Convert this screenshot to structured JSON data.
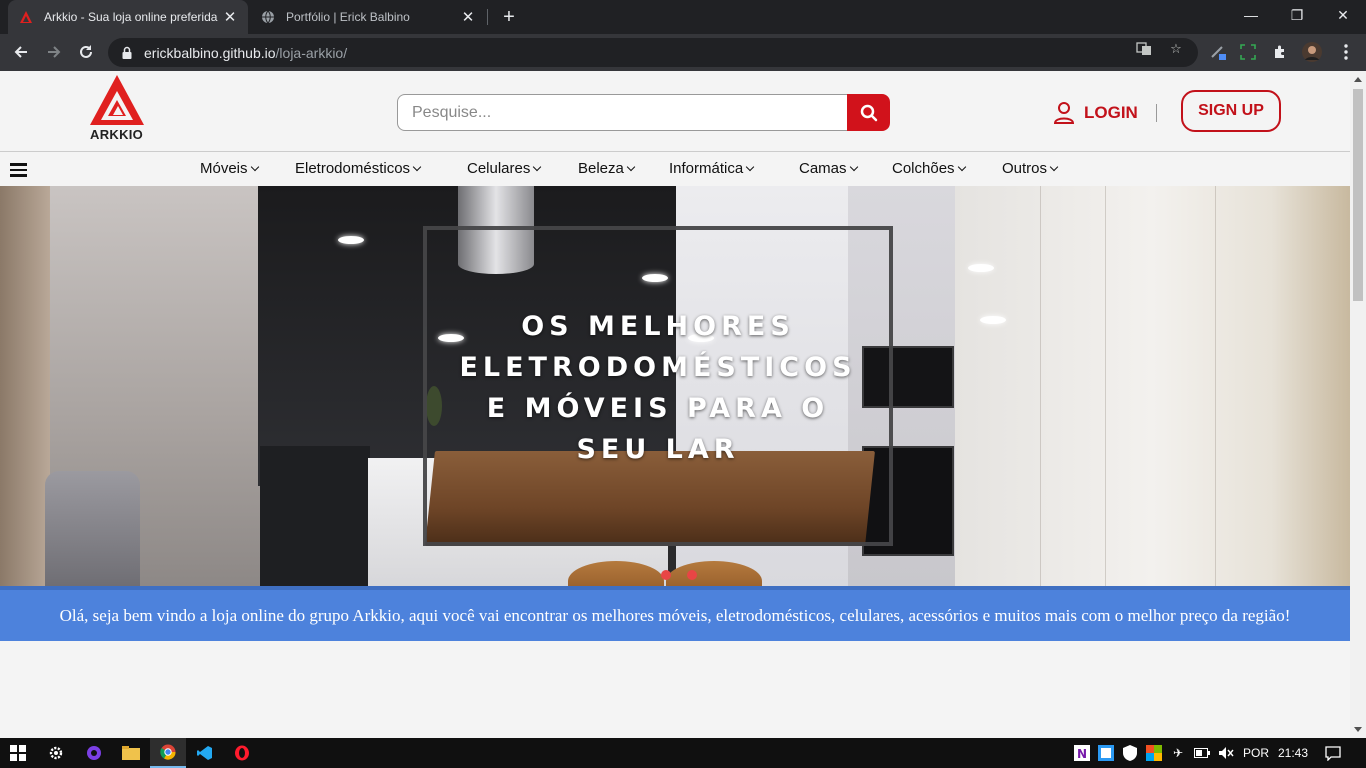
{
  "browser": {
    "tabs": [
      {
        "title": "Arkkio - Sua loja online preferida",
        "active": true
      },
      {
        "title": "Portfólio | Erick Balbino",
        "active": false
      }
    ],
    "url_host": "erickbalbino.github.io",
    "url_path": "/loja-arkkio/"
  },
  "header": {
    "logo_text": "ARKKIO",
    "search_placeholder": "Pesquise...",
    "login_label": "LOGIN",
    "separator": "|",
    "signup_label": "SIGN UP"
  },
  "nav": {
    "categories": [
      "Móveis",
      "Eletrodomésticos",
      "Celulares",
      "Beleza",
      "Informática",
      "Camas",
      "Colchões",
      "Outros"
    ]
  },
  "hero": {
    "lines": [
      "OS MELHORES",
      "ELETRODOMÉSTICOS",
      "E MÓVEIS PARA O",
      "SEU LAR"
    ]
  },
  "banner": {
    "text": "Olá, seja bem vindo a loja online do grupo Arkkio, aqui você vai encontrar os melhores móveis, eletrodomésticos, celulares, acessórios e muitos mais com o melhor preço da região!"
  },
  "taskbar": {
    "language": "POR",
    "time": "21:43"
  },
  "colors": {
    "brand_red": "#d1121b",
    "banner_blue": "#4d82dc"
  }
}
